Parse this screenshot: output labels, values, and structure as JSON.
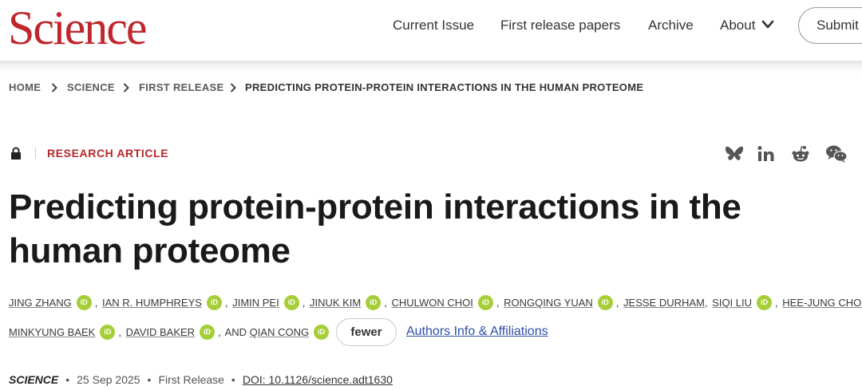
{
  "header": {
    "logo": "Science",
    "nav": [
      "Current Issue",
      "First release papers",
      "Archive",
      "About"
    ],
    "submit_label": "Submit"
  },
  "breadcrumb": [
    "HOME",
    "SCIENCE",
    "FIRST RELEASE",
    "PREDICTING PROTEIN-PROTEIN INTERACTIONS IN THE HUMAN PROTEOME"
  ],
  "article": {
    "type": "RESEARCH ARTICLE",
    "title": "Predicting protein-protein interactions in the human proteome",
    "authors_line1": [
      "JING ZHANG",
      "IAN R. HUMPHREYS",
      "JIMIN PEI",
      "JINUK KIM",
      "CHULWON CHOI",
      "RONGQING YUAN",
      "JESSE DURHAM",
      "SIQI LIU",
      "HEE-JUNG CHOI"
    ],
    "authors_line2": [
      "MINKYUNG BAEK",
      "DAVID BAKER",
      "QIAN CONG"
    ],
    "and_label": "AND",
    "orcid_label": "iD",
    "fewer_label": "fewer",
    "affiliations_link": "Authors Info & Affiliations",
    "journal": "SCIENCE",
    "date": "25 Sep 2025",
    "release": "First Release",
    "doi": "DOI: 10.1126/science.adt1630"
  },
  "share_icons": [
    "bluesky-icon",
    "linkedin-icon",
    "reddit-icon",
    "wechat-icon"
  ],
  "colors": {
    "brand": "#c0272d",
    "orcid": "#a6ce39",
    "link": "#2b4ea8"
  }
}
